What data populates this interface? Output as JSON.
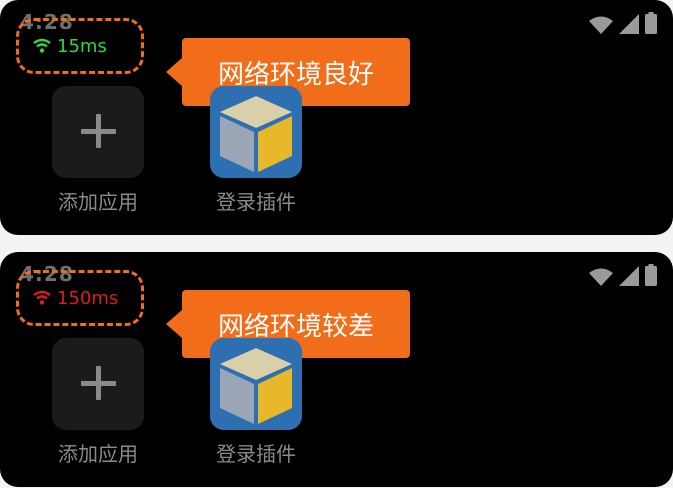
{
  "colors": {
    "accent": "#f26d1a",
    "good": "#2fd83c",
    "bad": "#e01b1b",
    "panel": "#000000",
    "page": "#f2f3f5"
  },
  "panels": [
    {
      "clock": "4:28",
      "latency": {
        "value": "15ms",
        "icon": "wifi-icon",
        "quality": "good"
      },
      "callout": "网络环境良好",
      "apps": [
        {
          "label": "添加应用",
          "icon": "plus-icon"
        },
        {
          "label": "登录插件",
          "icon": "plugin-cube-icon"
        }
      ]
    },
    {
      "clock": "4:28",
      "latency": {
        "value": "150ms",
        "icon": "wifi-icon",
        "quality": "bad"
      },
      "callout": "网络环境较差",
      "apps": [
        {
          "label": "添加应用",
          "icon": "plus-icon"
        },
        {
          "label": "登录插件",
          "icon": "plugin-cube-icon"
        }
      ]
    }
  ]
}
